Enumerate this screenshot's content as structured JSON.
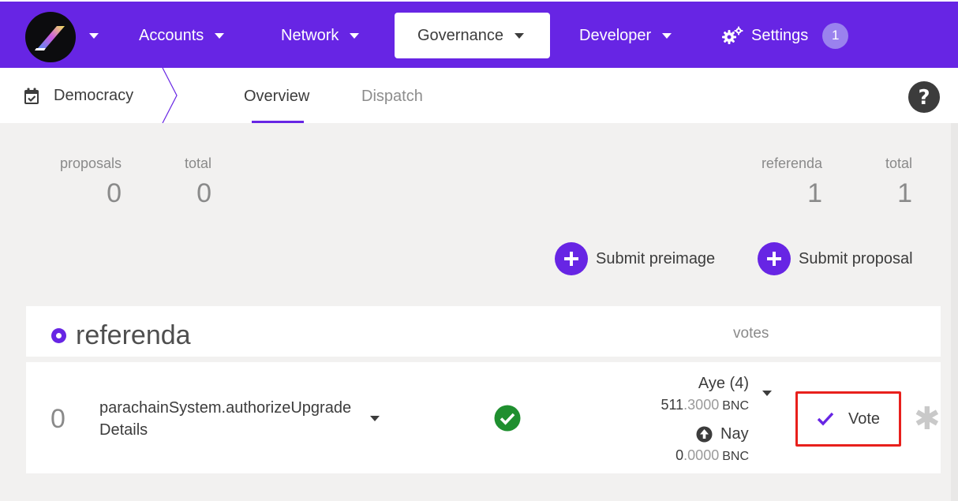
{
  "topnav": {
    "accent": "#6725e4",
    "items": [
      {
        "label": "Accounts"
      },
      {
        "label": "Network"
      },
      {
        "label": "Governance"
      },
      {
        "label": "Developer"
      },
      {
        "label": "Settings",
        "badge": "1"
      }
    ]
  },
  "subnav": {
    "section": "Democracy",
    "tabs": [
      {
        "label": "Overview",
        "active": true
      },
      {
        "label": "Dispatch",
        "active": false
      }
    ]
  },
  "summary": {
    "proposals": {
      "label": "proposals",
      "value": "0"
    },
    "proposals_total": {
      "label": "total",
      "value": "0"
    },
    "referenda": {
      "label": "referenda",
      "value": "1"
    },
    "referenda_total": {
      "label": "total",
      "value": "1"
    }
  },
  "actions": {
    "submit_preimage": "Submit preimage",
    "submit_proposal": "Submit proposal"
  },
  "referenda_table": {
    "title": "referenda",
    "votes_header": "votes",
    "rows": [
      {
        "index": "0",
        "call": "parachainSystem.authorizeUpgrade",
        "details": "Details",
        "aye_label": "Aye (4)",
        "aye_int": "511",
        "aye_dec": ".3000",
        "nay_label": "Nay",
        "nay_int": "0",
        "nay_dec": ".0000",
        "unit": "BNC",
        "vote_label": "Vote",
        "status": "passing"
      }
    ]
  }
}
